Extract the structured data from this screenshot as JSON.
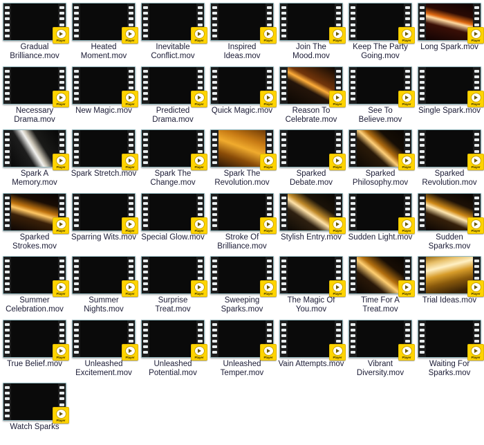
{
  "view": {
    "name": "video-thumbnail-grid",
    "columns": 7,
    "badge_label": "Player",
    "badge_color": "#ffd400",
    "caption_color": "#1b1b35",
    "background_color": "#ffffff",
    "filmstrip_border_color": "#8fb6bd",
    "sprocket_color": "#e8eced",
    "sprocket_count": 6
  },
  "items": [
    {
      "name": "Gradual Brilliance.mov",
      "thumb": "dark-empty"
    },
    {
      "name": "Heated Moment.mov",
      "thumb": "spark-vertical"
    },
    {
      "name": "Inevitable Conflict.mov",
      "thumb": "burst-left"
    },
    {
      "name": "Inspired Ideas.mov",
      "thumb": "bright-amber-rays"
    },
    {
      "name": "Join The Mood.mov",
      "thumb": "streaks-crossing"
    },
    {
      "name": "Keep The Party Going.mov",
      "thumb": "dark-violet-burst"
    },
    {
      "name": "Long Spark.mov",
      "thumb": "long-arc-streak"
    },
    {
      "name": "Necessary Drama.mov",
      "thumb": "white-curve"
    },
    {
      "name": "New Magic.mov",
      "thumb": "bottom-glow"
    },
    {
      "name": "Predicted Drama.mov",
      "thumb": "golden-spray"
    },
    {
      "name": "Quick Magic.mov",
      "thumb": "warm-dark-spark"
    },
    {
      "name": "Reason To Celebrate.mov",
      "thumb": "orange-streaks"
    },
    {
      "name": "See To Believe.mov",
      "thumb": "fountain-gold"
    },
    {
      "name": "Single Spark.mov",
      "thumb": "red-spark-burst"
    },
    {
      "name": "Spark A Memory.mov",
      "thumb": "white-streaks"
    },
    {
      "name": "Spark Stretch.mov",
      "thumb": "red-fountain"
    },
    {
      "name": "Spark The Change.mov",
      "thumb": "green-burst"
    },
    {
      "name": "Spark The Revolution.mov",
      "thumb": "amber-wash"
    },
    {
      "name": "Sparked Debate.mov",
      "thumb": "violet-firework"
    },
    {
      "name": "Sparked Philosophy.mov",
      "thumb": "golden-x-streak"
    },
    {
      "name": "Sparked Revolution.mov",
      "thumb": "dark-black"
    },
    {
      "name": "Sparked Strokes.mov",
      "thumb": "amber-arc"
    },
    {
      "name": "Sparring Wits.mov",
      "thumb": "white-column"
    },
    {
      "name": "Special Glow.mov",
      "thumb": "blue-swirl"
    },
    {
      "name": "Stroke Of Brilliance.mov",
      "thumb": "gold-scatter"
    },
    {
      "name": "Stylish Entry.mov",
      "thumb": "crossed-beams"
    },
    {
      "name": "Sudden Light.mov",
      "thumb": "amber-bloom"
    },
    {
      "name": "Sudden Sparks.mov",
      "thumb": "bright-streak"
    },
    {
      "name": "Summer Celebration.mov",
      "thumb": "low-glow"
    },
    {
      "name": "Summer Nights.mov",
      "thumb": "dim-sparks"
    },
    {
      "name": "Surprise Treat.mov",
      "thumb": "violet-pillar"
    },
    {
      "name": "Sweeping Sparks.mov",
      "thumb": "sweeping-gold"
    },
    {
      "name": "The Magic Of You.mov",
      "thumb": "sparse-streaks"
    },
    {
      "name": "Time For A Treat.mov",
      "thumb": "diagonal-gold"
    },
    {
      "name": "Trial Ideas.mov",
      "thumb": "wide-gold-bands"
    },
    {
      "name": "True Belief.mov",
      "thumb": "pale-curve"
    },
    {
      "name": "Unleashed Excitement.mov",
      "thumb": "amber-spray"
    },
    {
      "name": "Unleashed Potential.mov",
      "thumb": "red-haze"
    },
    {
      "name": "Unleashed Temper.mov",
      "thumb": "orange-fan"
    },
    {
      "name": "Vain Attempts.mov",
      "thumb": "single-point"
    },
    {
      "name": "Vibrant Diversity.mov",
      "thumb": "amber-column"
    },
    {
      "name": "Waiting For Sparks.mov",
      "thumb": "faint-spark"
    },
    {
      "name": "Watch Sparks",
      "thumb": "gold-lens-flare"
    }
  ]
}
